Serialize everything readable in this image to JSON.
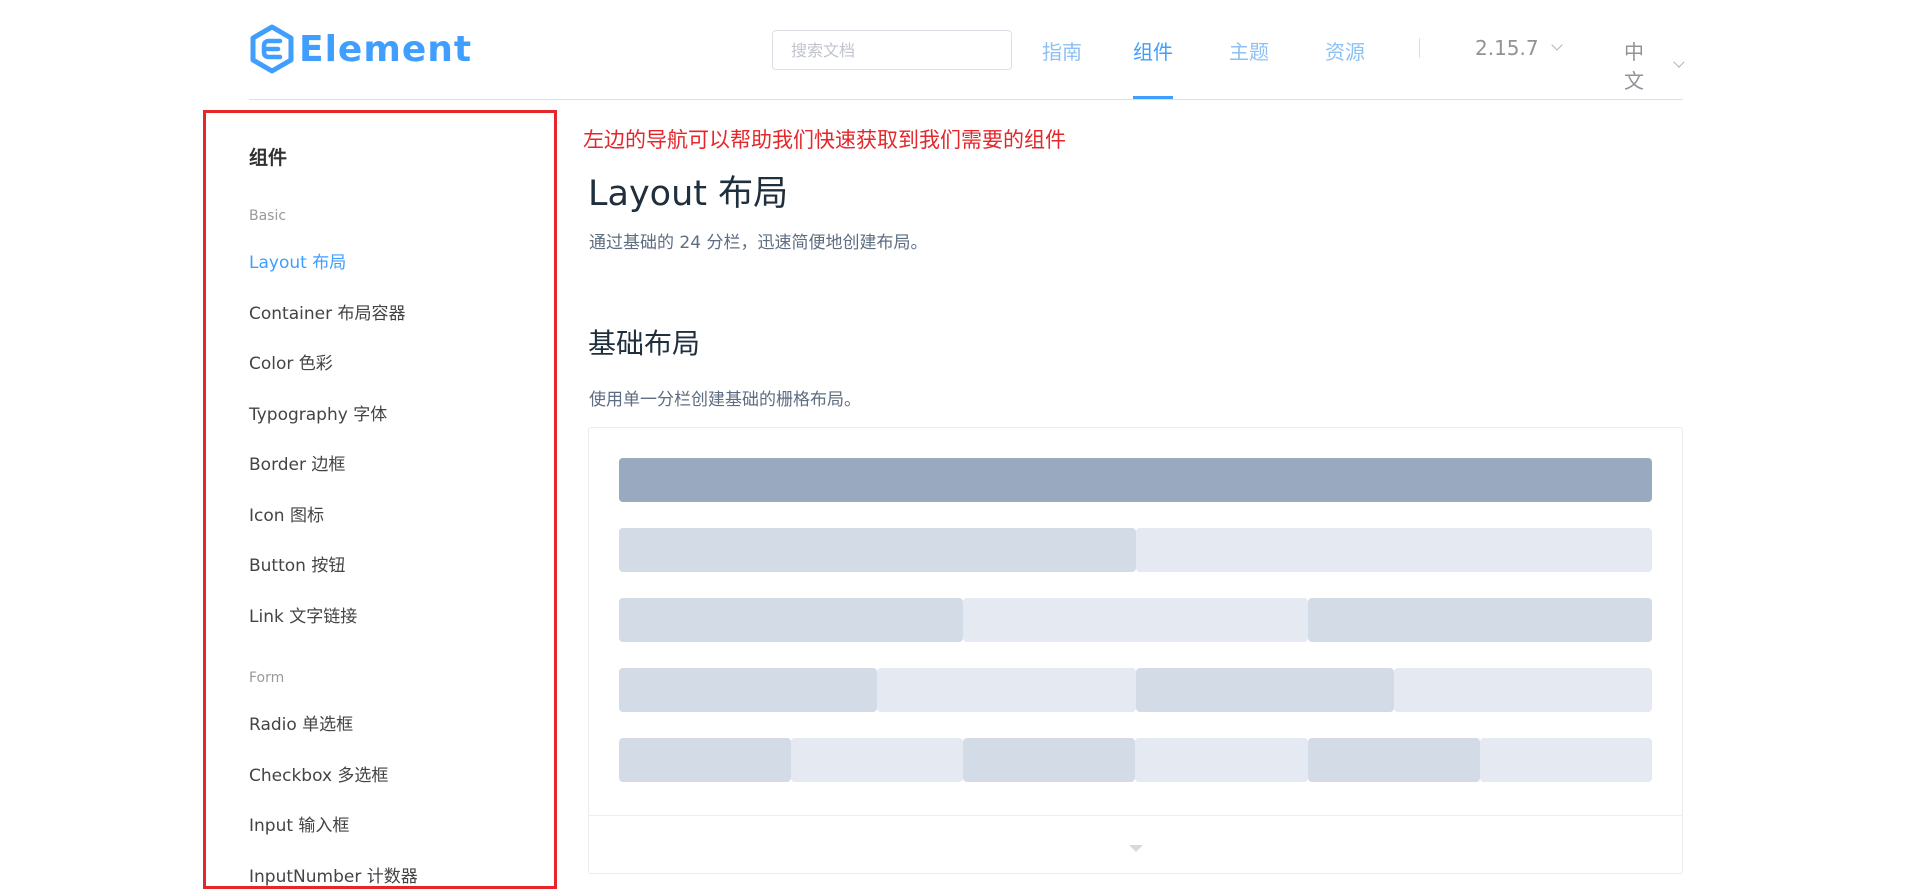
{
  "header": {
    "logo_text": "Element",
    "search_placeholder": "搜索文档",
    "nav": [
      "指南",
      "组件",
      "主题",
      "资源"
    ],
    "active_nav": "组件",
    "version": "2.15.7",
    "language": "中文"
  },
  "sidebar": {
    "title": "组件",
    "groups": [
      {
        "label": "Basic",
        "items": [
          "Layout 布局",
          "Container 布局容器",
          "Color 色彩",
          "Typography 字体",
          "Border 边框",
          "Icon 图标",
          "Button 按钮",
          "Link 文字链接"
        ]
      },
      {
        "label": "Form",
        "items": [
          "Radio 单选框",
          "Checkbox 多选框",
          "Input 输入框",
          "InputNumber 计数器"
        ]
      }
    ],
    "active_item": "Layout 布局"
  },
  "annotation": "左边的导航可以帮助我们快速获取到我们需要的组件",
  "main": {
    "title": "Layout 布局",
    "description": "通过基础的 24 分栏，迅速简便地创建布局。",
    "section_title": "基础布局",
    "section_description": "使用单一分栏创建基础的栅格布局。",
    "demo_rows": [
      [
        24
      ],
      [
        12,
        12
      ],
      [
        8,
        8,
        8
      ],
      [
        6,
        6,
        6,
        6
      ],
      [
        4,
        4,
        4,
        4,
        4,
        4
      ]
    ]
  },
  "colors": {
    "accent": "#409eff",
    "annotation_red": "#e5262a",
    "grid_dark": "#99a9bf",
    "grid": "#d3dce6",
    "grid_light": "#e5e9f2"
  }
}
